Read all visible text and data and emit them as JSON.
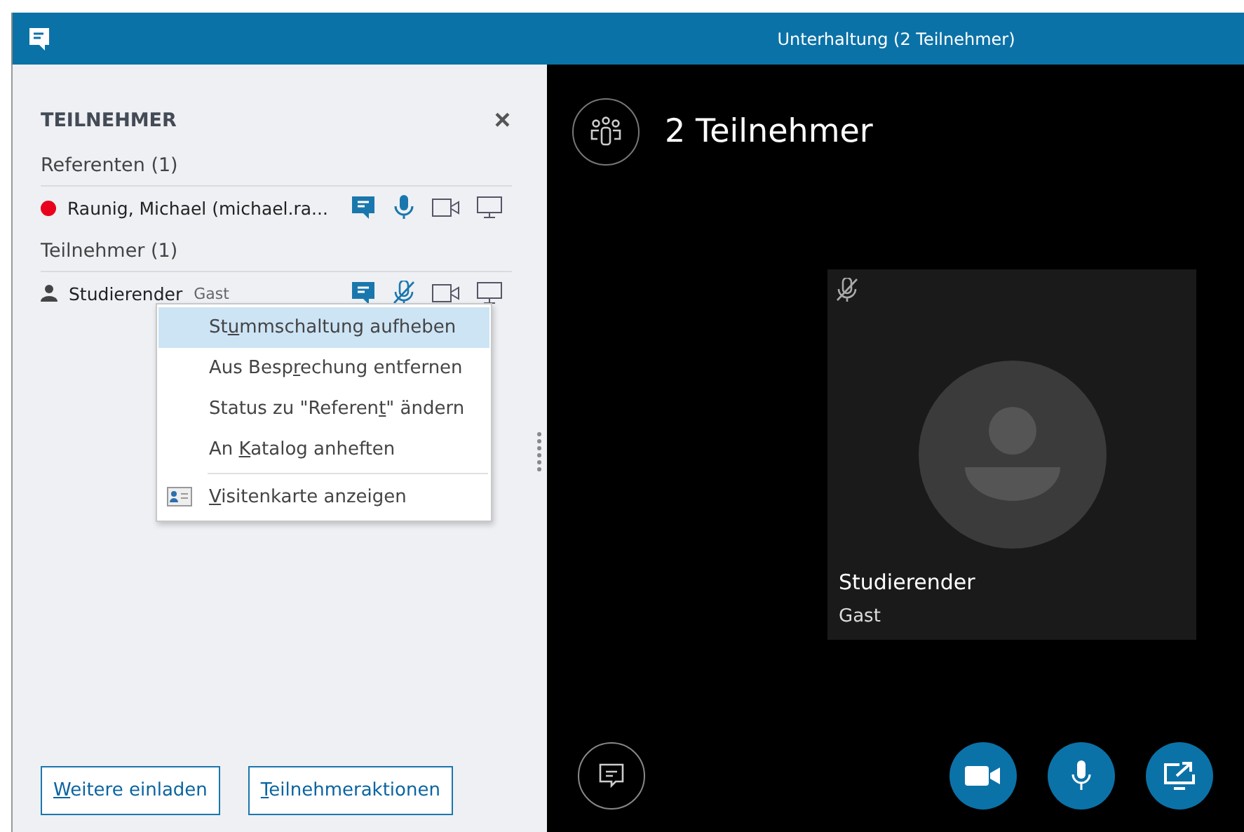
{
  "window": {
    "title": "Unterhaltung (2 Teilnehmer)"
  },
  "panel": {
    "title": "TEILNEHMER",
    "close": "×",
    "groups": [
      {
        "label": "Referenten (1)",
        "people": [
          {
            "kind": "presenter",
            "name": "Raunig, Michael (michael.ra...",
            "color": "#e8001c",
            "mic_muted": false
          }
        ]
      },
      {
        "label": "Teilnehmer (1)",
        "people": [
          {
            "kind": "guest",
            "name": "Studierender",
            "role": "Gast",
            "mic_muted": true
          }
        ]
      }
    ],
    "context_menu": [
      {
        "kind": "text",
        "before": "St",
        "key": "u",
        "after": "mmschaltung aufheben",
        "selected": true
      },
      {
        "kind": "text",
        "before": "Aus Besp",
        "key": "r",
        "after": "echung entfernen",
        "selected": false
      },
      {
        "kind": "text",
        "before": "Status zu \"Referen",
        "key": "t",
        "after": "\" ändern",
        "selected": false
      },
      {
        "kind": "text",
        "before": "An ",
        "key": "K",
        "after": "atalog anheften",
        "selected": false
      },
      {
        "kind": "card",
        "key": "V",
        "after": "isitenkarte anzeigen",
        "selected": false
      }
    ],
    "buttons": [
      {
        "key": "W",
        "after": "eitere einladen"
      },
      {
        "key": "T",
        "after": "eilnehmeraktionen"
      }
    ]
  },
  "stage": {
    "count": "2 Teilnehmer",
    "tile": {
      "name": "Studierender",
      "role": "Gast",
      "mic_muted": true
    }
  }
}
